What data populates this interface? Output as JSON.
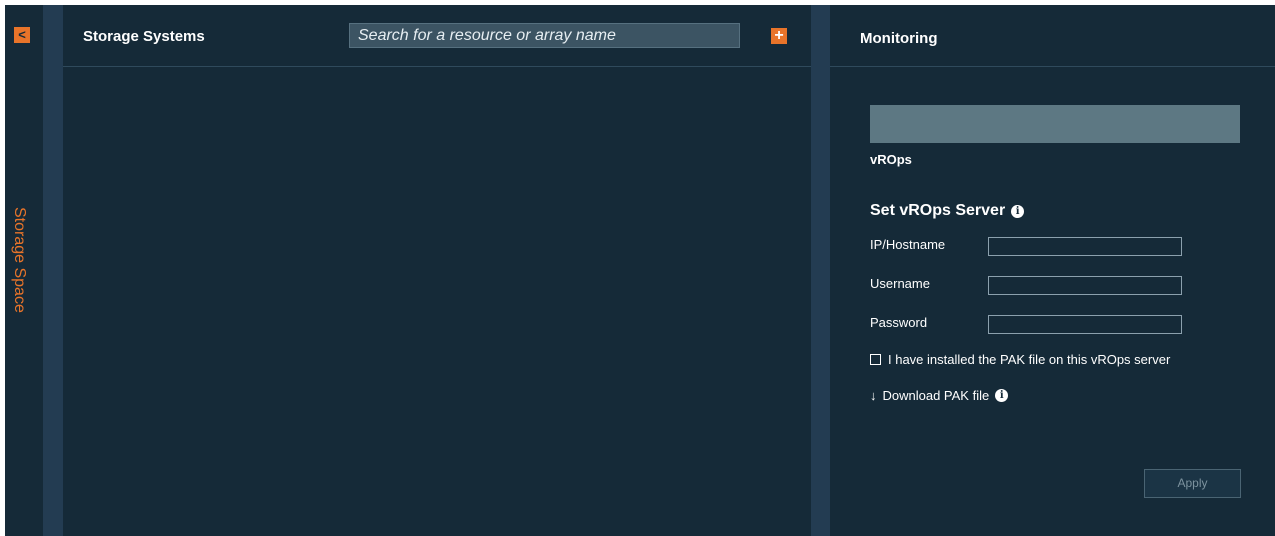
{
  "sidebar": {
    "collapse_glyph": "<",
    "collapse_icon": "chevron-left-icon",
    "label": "Storage Space"
  },
  "storage_panel": {
    "title": "Storage Systems",
    "search": {
      "placeholder": "Search for a resource or array name",
      "value": ""
    },
    "add_glyph": "+",
    "add_icon": "plus-icon"
  },
  "monitoring_panel": {
    "title": "Monitoring",
    "logo_caption": "vROps",
    "section_title": "Set vROps Server",
    "info_glyph": "i",
    "fields": [
      {
        "label": "IP/Hostname",
        "value": ""
      },
      {
        "label": "Username",
        "value": ""
      },
      {
        "label": "Password",
        "value": ""
      }
    ],
    "checkbox_label": "I have installed the PAK file on this vROps server",
    "checkbox_checked": false,
    "download_glyph": "↓",
    "download_label": "Download PAK file",
    "apply_label": "Apply"
  },
  "colors": {
    "background": "#152a38",
    "gutter": "#233c52",
    "accent": "#e8742a",
    "logo_placeholder": "#5d7883"
  }
}
